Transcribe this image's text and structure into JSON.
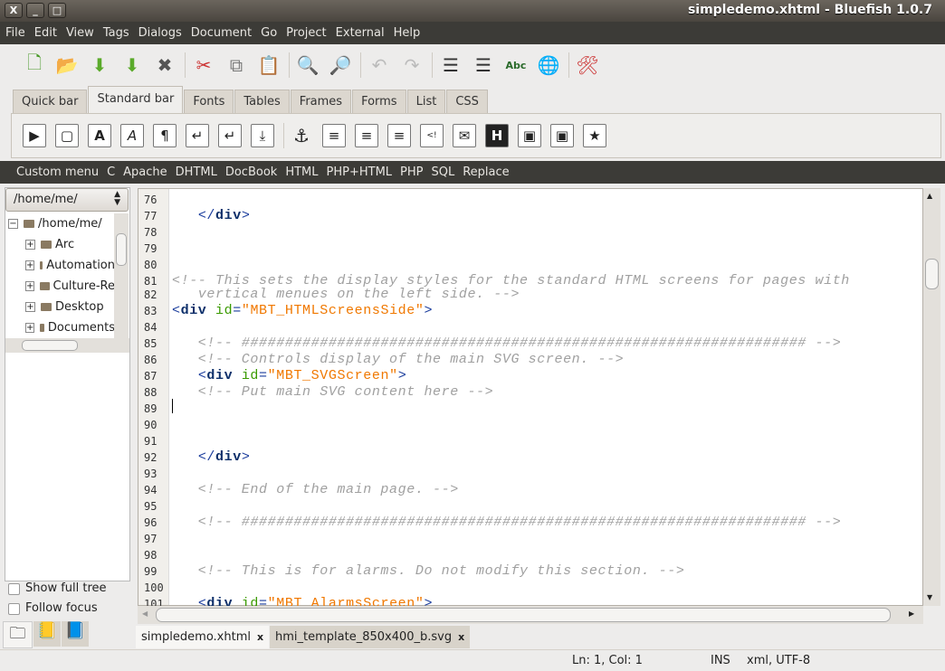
{
  "window": {
    "title": "simpledemo.xhtml - Bluefish 1.0.7",
    "close": "X",
    "minimize": "_",
    "maximize": "□"
  },
  "menu": [
    "File",
    "Edit",
    "View",
    "Tags",
    "Dialogs",
    "Document",
    "Go",
    "Project",
    "External",
    "Help"
  ],
  "toolbar": [
    {
      "icon": "new-file-icon",
      "glyph": "🗋",
      "color": "#4a9a2a"
    },
    {
      "icon": "open-file-icon",
      "glyph": "📂",
      "color": "#d9441c"
    },
    {
      "icon": "save-icon",
      "glyph": "⬇",
      "color": "#5aaa2a"
    },
    {
      "icon": "save-as-icon",
      "glyph": "⬇",
      "color": "#5aaa2a"
    },
    {
      "icon": "close-icon",
      "glyph": "✖",
      "color": "#555"
    },
    "sep",
    {
      "icon": "cut-icon",
      "glyph": "✂",
      "color": "#c33"
    },
    {
      "icon": "copy-icon",
      "glyph": "⧉",
      "color": "#777"
    },
    {
      "icon": "paste-icon",
      "glyph": "📋",
      "color": "#8a6a3a"
    },
    "sep",
    {
      "icon": "search-icon",
      "glyph": "🔍",
      "color": "#333"
    },
    {
      "icon": "search-replace-icon",
      "glyph": "🔎",
      "color": "#333"
    },
    "sep",
    {
      "icon": "undo-icon",
      "glyph": "↶",
      "color": "#bbb"
    },
    {
      "icon": "redo-icon",
      "glyph": "↷",
      "color": "#bbb"
    },
    "sep",
    {
      "icon": "unindent-icon",
      "glyph": "☰",
      "color": "#333"
    },
    {
      "icon": "indent-icon",
      "glyph": "☰",
      "color": "#333"
    },
    {
      "icon": "spellcheck-icon",
      "glyph": "Abc",
      "color": "#2a6a2a"
    },
    {
      "icon": "preview-browser-icon",
      "glyph": "🌐",
      "color": "#2a5a9a"
    },
    "sep",
    {
      "icon": "preferences-icon",
      "glyph": "🛠",
      "color": "#c33"
    }
  ],
  "tabs": [
    "Quick bar",
    "Standard bar",
    "Fonts",
    "Tables",
    "Frames",
    "Forms",
    "List",
    "CSS"
  ],
  "active_tab": "Standard bar",
  "standard_bar": [
    {
      "icon": "quickstart-icon",
      "glyph": "▶"
    },
    {
      "icon": "body-icon",
      "glyph": "▢"
    },
    {
      "icon": "bold-icon",
      "glyph": "A"
    },
    {
      "icon": "italic-icon",
      "glyph": "A"
    },
    {
      "icon": "paragraph-icon",
      "glyph": "¶"
    },
    {
      "icon": "break-icon",
      "glyph": "↵"
    },
    {
      "icon": "break-clear-icon",
      "glyph": "↵"
    },
    {
      "icon": "nbsp-icon",
      "glyph": "⤓"
    },
    {
      "icon": "anchor-icon",
      "glyph": "⚓"
    },
    {
      "icon": "align-left-icon",
      "glyph": "≡"
    },
    {
      "icon": "center-icon",
      "glyph": "≡"
    },
    {
      "icon": "align-right-icon",
      "glyph": "≡"
    },
    {
      "icon": "comment-icon",
      "glyph": "<!"
    },
    {
      "icon": "email-icon",
      "glyph": "✉"
    },
    {
      "icon": "heading-icon",
      "glyph": "H"
    },
    {
      "icon": "image-icon",
      "glyph": "▣"
    },
    {
      "icon": "thumbnail-icon",
      "glyph": "▣"
    },
    {
      "icon": "multi-thumbnail-icon",
      "glyph": "★"
    }
  ],
  "custom_menu": [
    "Custom menu",
    "C",
    "Apache",
    "DHTML",
    "DocBook",
    "HTML",
    "PHP+HTML",
    "PHP",
    "SQL",
    "Replace"
  ],
  "file_browser": {
    "dir": "/home/me/",
    "root": "/home/me/",
    "items": [
      "Arc",
      "Automation",
      "Culture-Re",
      "Desktop",
      "Documents"
    ],
    "show_full_tree": "Show full tree",
    "follow_focus": "Follow focus"
  },
  "side_tabs": [
    {
      "icon": "filebrowser-tab-icon"
    },
    {
      "icon": "bookmarks-tab-icon"
    },
    {
      "icon": "reference-tab-icon"
    }
  ],
  "editor": {
    "lines": [
      {
        "n": "76",
        "seg": []
      },
      {
        "n": "77",
        "seg": [
          [
            "   ",
            ""
          ],
          [
            "</",
            "tag"
          ],
          [
            "div",
            "tagname"
          ],
          [
            ">",
            "tag"
          ]
        ]
      },
      {
        "n": "78",
        "seg": []
      },
      {
        "n": "79",
        "seg": []
      },
      {
        "n": "80",
        "seg": []
      },
      {
        "n": "81",
        "seg": [
          [
            "<!-- This sets the display styles for the standard HTML screens for pages with",
            "comment"
          ]
        ]
      },
      {
        "n": "82",
        "seg": [
          [
            "   vertical menues on the left side. -->",
            "comment"
          ]
        ]
      },
      {
        "n": "83",
        "seg": [
          [
            "<",
            "tag"
          ],
          [
            "div",
            "tagname"
          ],
          [
            " id",
            "attr"
          ],
          [
            "=",
            "tag"
          ],
          [
            "\"MBT_HTMLScreensSide\"",
            "str"
          ],
          [
            ">",
            "tag"
          ]
        ]
      },
      {
        "n": "84",
        "seg": []
      },
      {
        "n": "85",
        "seg": [
          [
            "   <!-- ################################################################# -->",
            "comment"
          ]
        ]
      },
      {
        "n": "86",
        "seg": [
          [
            "   <!-- Controls display of the main SVG screen. -->",
            "comment"
          ]
        ]
      },
      {
        "n": "87",
        "seg": [
          [
            "   ",
            ""
          ],
          [
            "<",
            "tag"
          ],
          [
            "div",
            "tagname"
          ],
          [
            " id",
            "attr"
          ],
          [
            "=",
            "tag"
          ],
          [
            "\"MBT_SVGScreen\"",
            "str"
          ],
          [
            ">",
            "tag"
          ]
        ]
      },
      {
        "n": "88",
        "seg": [
          [
            "   <!-- Put main SVG content here -->",
            "comment"
          ]
        ]
      },
      {
        "n": "89",
        "seg": []
      },
      {
        "n": "90",
        "seg": []
      },
      {
        "n": "91",
        "seg": []
      },
      {
        "n": "92",
        "seg": [
          [
            "   ",
            ""
          ],
          [
            "</",
            "tag"
          ],
          [
            "div",
            "tagname"
          ],
          [
            ">",
            "tag"
          ]
        ]
      },
      {
        "n": "93",
        "seg": []
      },
      {
        "n": "94",
        "seg": [
          [
            "   <!-- End of the main page. -->",
            "comment"
          ]
        ]
      },
      {
        "n": "95",
        "seg": []
      },
      {
        "n": "96",
        "seg": [
          [
            "   <!-- ################################################################# -->",
            "comment"
          ]
        ]
      },
      {
        "n": "97",
        "seg": []
      },
      {
        "n": "98",
        "seg": []
      },
      {
        "n": "99",
        "seg": [
          [
            "   <!-- This is for alarms. Do not modify this section. -->",
            "comment"
          ]
        ]
      },
      {
        "n": "100",
        "seg": []
      },
      {
        "n": "101",
        "seg": [
          [
            "   ",
            ""
          ],
          [
            "<",
            "tag"
          ],
          [
            "div",
            "tagname"
          ],
          [
            " id",
            "attr"
          ],
          [
            "=",
            "tag"
          ],
          [
            "\"MBT_AlarmsScreen\"",
            "str"
          ],
          [
            ">",
            "tag"
          ]
        ]
      }
    ]
  },
  "doc_tabs": [
    {
      "label": "simpledemo.xhtml",
      "close": "x",
      "active": true
    },
    {
      "label": "hmi_template_850x400_b.svg",
      "close": "x",
      "active": false
    }
  ],
  "status": {
    "position": "Ln: 1, Col: 1",
    "mode": "INS",
    "encoding": "xml, UTF-8"
  }
}
